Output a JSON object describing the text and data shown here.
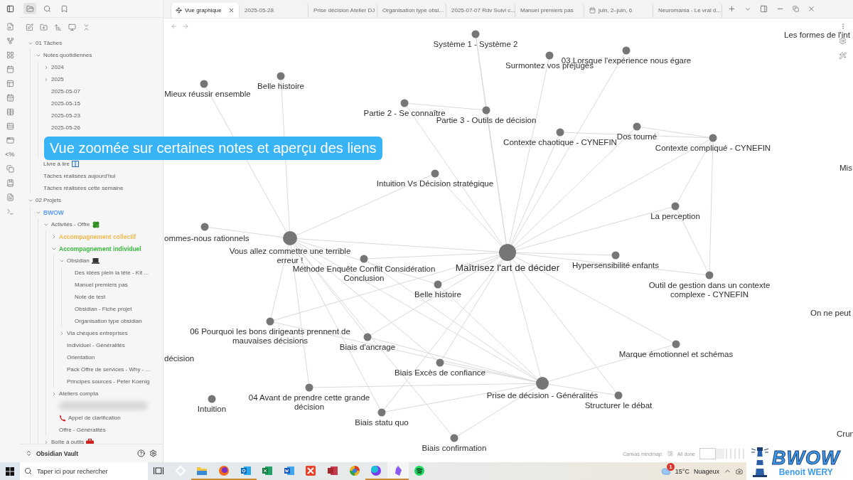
{
  "sidebar": {
    "tabs": [
      {
        "kind": "files",
        "selected": true
      },
      {
        "kind": "search",
        "selected": false
      },
      {
        "kind": "bookmarks",
        "selected": false
      }
    ],
    "ribbon_glyph": "<%",
    "tree": [
      {
        "label": "01 Tâches",
        "expanded": true,
        "children": [
          {
            "label": "Notes quotidiennes",
            "expanded": true,
            "children": [
              {
                "label": "2024",
                "expanded": false
              },
              {
                "label": "2025",
                "expanded": false
              },
              {
                "label": "2025-05-07"
              },
              {
                "label": "2025-05-15"
              },
              {
                "label": "2025-05-23"
              },
              {
                "label": "2025-05-26"
              },
              {
                "kind": "covered"
              },
              {
                "kind": "covered"
              }
            ]
          },
          {
            "label": "Livre à lire"
          },
          {
            "label": "Tâches réalisées aujourd'hui"
          },
          {
            "label": "Tâches réalisées cette semaine"
          }
        ]
      },
      {
        "label": "02 Projets",
        "expanded": true,
        "children": [
          {
            "label": "BWOW",
            "expanded": true,
            "color": "#5b9cf2",
            "children": [
              {
                "label": "Activités - Offre",
                "expanded": true,
                "children": [
                  {
                    "label": "Accompagnement collectif",
                    "expanded": false,
                    "color": "#f2b84b"
                  },
                  {
                    "label": "Accompagnement individuel",
                    "expanded": true,
                    "color": "#35b83a",
                    "children": [
                      {
                        "label": "Obsidian",
                        "expanded": true,
                        "children": [
                          {
                            "label": "Des idées plein la tête - Kit ..."
                          },
                          {
                            "label": "Manuel premiers pas"
                          },
                          {
                            "label": "Note de test"
                          },
                          {
                            "label": "Obsidian - Fiche projet"
                          },
                          {
                            "label": "Organisation type obsidian"
                          }
                        ]
                      },
                      {
                        "label": "Via chèques entreprises",
                        "expanded": false
                      },
                      {
                        "label": "Individuel - Généralités"
                      },
                      {
                        "label": "Orientation"
                      },
                      {
                        "label": "Pack Offre de services - Why - ..."
                      },
                      {
                        "label": "Principes sources - Peter Koenig"
                      }
                    ]
                  },
                  {
                    "label": "Ateliers compta",
                    "expanded": false
                  },
                  {
                    "kind": "redacted"
                  },
                  {
                    "label": "Appel de clarification"
                  },
                  {
                    "label": "Offre - Généralités"
                  }
                ]
              },
              {
                "label": "Boîte à outils",
                "expanded": false
              }
            ]
          }
        ]
      }
    ],
    "vault": "Obsidian Vault"
  },
  "tabs": [
    {
      "label": "Vue graphique",
      "kind": "graph",
      "selected": true
    },
    {
      "label": "2025-05-28",
      "kind": "note",
      "selected": false
    },
    {
      "label": "Prise décision Atelier DJ",
      "kind": "note",
      "selected": false
    },
    {
      "label": "Organisation type obsi...",
      "kind": "note",
      "selected": false
    },
    {
      "label": "2025-07-07 Rdv Suivi c...",
      "kind": "note",
      "selected": false
    },
    {
      "label": "Manuel premiers pas",
      "kind": "note",
      "selected": false
    },
    {
      "label": "juin, 2–juin, 6",
      "kind": "calendar",
      "selected": false
    },
    {
      "label": "Neuromania - Le vrai d...",
      "kind": "note",
      "selected": false
    }
  ],
  "graph": {
    "nodes": [
      {
        "label": "Système 1 - Système 2",
        "kind": "note"
      },
      {
        "label": "Surmontez vos préjugés",
        "kind": "note"
      },
      {
        "label": "03 Lorsque l'expérience nous égare",
        "kind": "note"
      },
      {
        "label": "Les formes de l'int",
        "kind": "clipped"
      },
      {
        "label": "Mieux réussir ensemble",
        "kind": "note"
      },
      {
        "label": "Belle histoire",
        "kind": "note"
      },
      {
        "label": "Partie 2 - Se connaître",
        "kind": "note"
      },
      {
        "label": "Partie 3 - Outils de décision",
        "kind": "note"
      },
      {
        "label": "Contexte chaotique - CYNEFIN",
        "kind": "note"
      },
      {
        "label": "Dos tourné",
        "kind": "note"
      },
      {
        "label": "Contexte compliqué - CYNEFIN",
        "kind": "note"
      },
      {
        "label": "Mis",
        "kind": "clipped"
      },
      {
        "label": "Intuition Vs Décision stratégique",
        "kind": "note"
      },
      {
        "label": "La perception",
        "kind": "note"
      },
      {
        "label": "ommes-nous rationnels",
        "kind": "note"
      },
      {
        "label": "Vous allez commettre une terrible erreur !",
        "kind": "hub"
      },
      {
        "label": "Méthode Enquête Conflit Considération Conclusion",
        "kind": "note"
      },
      {
        "label": "Maîtrisez l'art de décider",
        "kind": "hub"
      },
      {
        "label": "Hypersensibilité enfants",
        "kind": "note"
      },
      {
        "label": "Belle histoire",
        "kind": "note"
      },
      {
        "label": "Outil de gestion dans un contexte complexe - CYNEFIN",
        "kind": "note"
      },
      {
        "label": "On ne peut",
        "kind": "clipped"
      },
      {
        "label": "06 Pourquoi les bons dirigeants prennent de mauvaises décisions",
        "kind": "note"
      },
      {
        "label": "Biais d'ancrage",
        "kind": "note"
      },
      {
        "label": "décision",
        "kind": "clipped"
      },
      {
        "label": "Marque émotionnel et schémas",
        "kind": "note"
      },
      {
        "label": "Biais Excès de confiance",
        "kind": "note"
      },
      {
        "label": "Prise de décision - Généralités",
        "kind": "hub"
      },
      {
        "label": "Intuition",
        "kind": "note"
      },
      {
        "label": "04 Avant de prendre cette grande décision",
        "kind": "note"
      },
      {
        "label": "Structurer le débat",
        "kind": "note"
      },
      {
        "label": "Biais statu quo",
        "kind": "note"
      },
      {
        "label": "Biais confirmation",
        "kind": "note"
      },
      {
        "label": "Crun",
        "kind": "clipped"
      }
    ]
  },
  "caption": "Vue zoomée sur certaines notes et aperçu des liens",
  "status_bar": {
    "plugin": "Canvas mindmap:",
    "state": "All done"
  },
  "taskbar": {
    "search": {
      "placeholder": "Taper ici pour rechercher"
    },
    "apps": [
      {
        "kind": "diamond",
        "running": false,
        "active": false
      },
      {
        "kind": "folder",
        "running": true,
        "active": false
      },
      {
        "kind": "fox",
        "running": true,
        "active": false
      },
      {
        "kind": "mail",
        "running": true,
        "active": false
      },
      {
        "kind": "sheet",
        "running": false,
        "active": false
      },
      {
        "kind": "doc",
        "running": false,
        "active": false
      },
      {
        "kind": "puzzle",
        "running": false,
        "active": false
      },
      {
        "kind": "db",
        "running": false,
        "active": false
      },
      {
        "kind": "wheel",
        "running": false,
        "active": false
      },
      {
        "kind": "canva",
        "running": true,
        "active": false
      },
      {
        "kind": "crystal",
        "running": true,
        "active": true
      },
      {
        "kind": "music",
        "running": false,
        "active": false
      }
    ],
    "weather": {
      "badge": "1",
      "temperature": "15°C",
      "condition": "Nuageux"
    }
  },
  "brand": {
    "name": "BWOW",
    "author": "Benoit WERY"
  }
}
